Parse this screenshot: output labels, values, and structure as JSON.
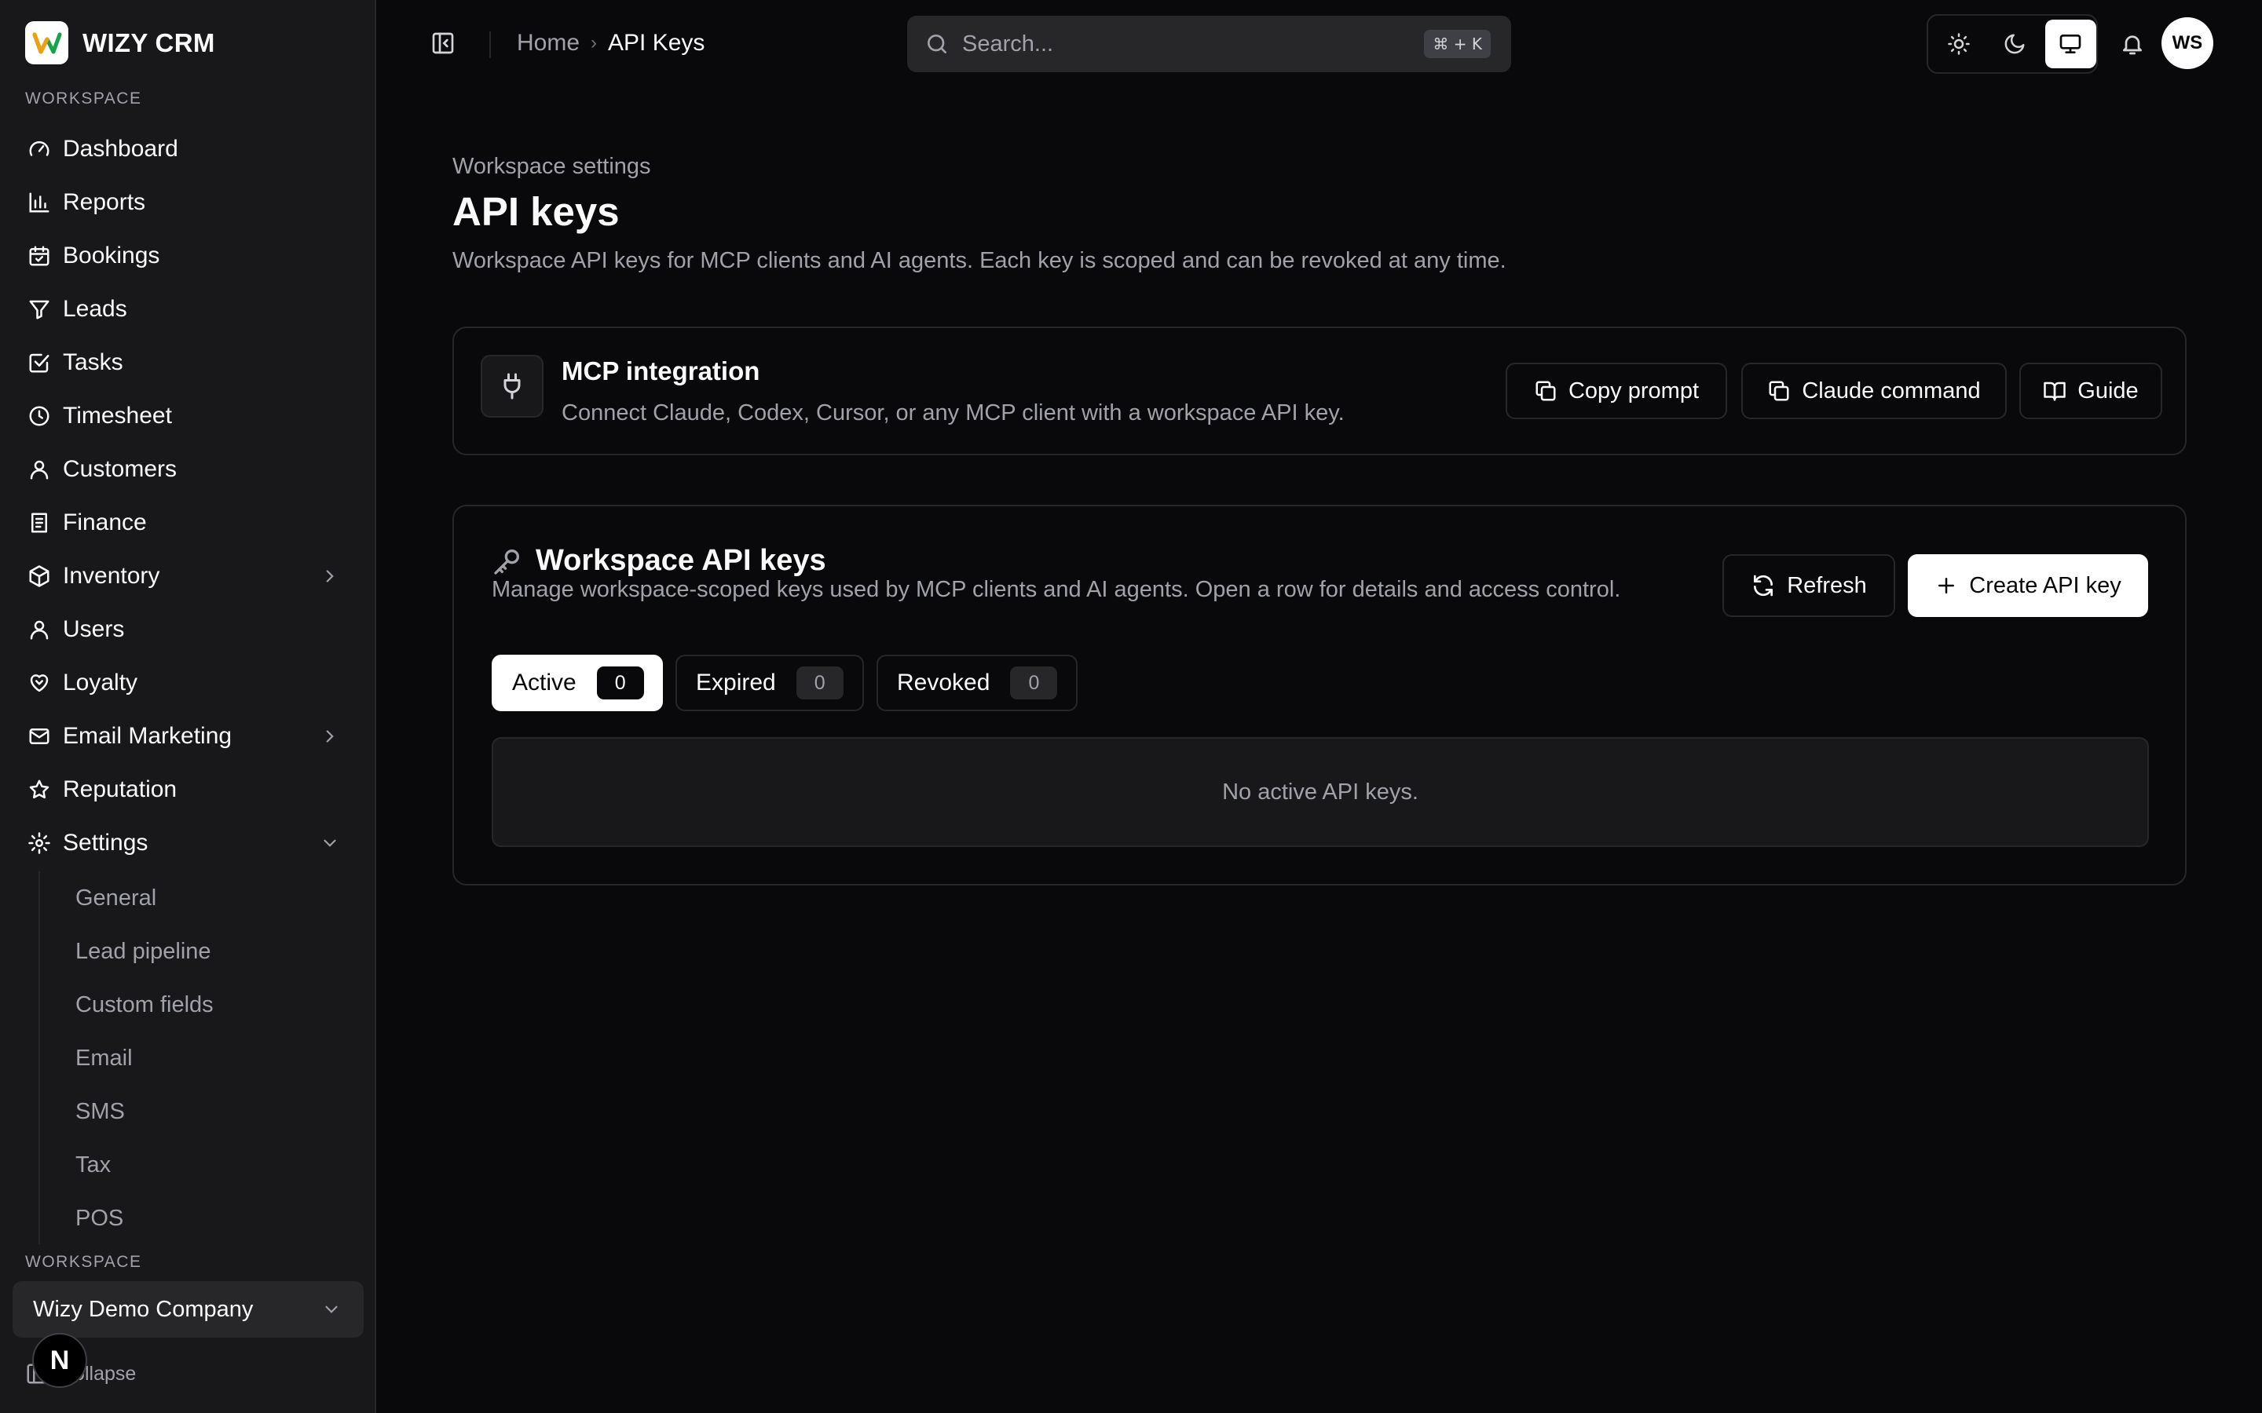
{
  "brand": {
    "name": "WIZY CRM"
  },
  "sidebar": {
    "section_label": "WORKSPACE",
    "items": [
      {
        "label": "Dashboard",
        "icon": "gauge-icon"
      },
      {
        "label": "Reports",
        "icon": "bar-chart-icon"
      },
      {
        "label": "Bookings",
        "icon": "calendar-check-icon"
      },
      {
        "label": "Leads",
        "icon": "funnel-icon"
      },
      {
        "label": "Tasks",
        "icon": "checkbox-icon"
      },
      {
        "label": "Timesheet",
        "icon": "clock-icon"
      },
      {
        "label": "Customers",
        "icon": "user-icon"
      },
      {
        "label": "Finance",
        "icon": "receipt-icon"
      },
      {
        "label": "Inventory",
        "icon": "box-icon"
      },
      {
        "label": "Users",
        "icon": "user-icon"
      },
      {
        "label": "Loyalty",
        "icon": "heart-handshake-icon"
      },
      {
        "label": "Email Marketing",
        "icon": "mail-icon"
      },
      {
        "label": "Reputation",
        "icon": "star-icon"
      },
      {
        "label": "Settings",
        "icon": "gear-icon"
      }
    ],
    "settings_sub": [
      "General",
      "Lead pipeline",
      "Custom fields",
      "Email",
      "SMS",
      "Tax",
      "POS"
    ],
    "workspace_label": "WORKSPACE",
    "workspace_name": "Wizy Demo Company",
    "collapse_label": "Collapse",
    "badge_letter": "N"
  },
  "topbar": {
    "breadcrumb": {
      "home": "Home",
      "separator": "›",
      "current": "API Keys"
    },
    "search": {
      "placeholder": "Search...",
      "shortcut": "⌘ + K"
    },
    "avatar_initials": "WS"
  },
  "page": {
    "eyebrow": "Workspace settings",
    "title": "API keys",
    "description": "Workspace API keys for MCP clients and AI agents. Each key is scoped and can be revoked at any time."
  },
  "mcp": {
    "title": "MCP integration",
    "description": "Connect Claude, Codex, Cursor, or any MCP client with a workspace API key.",
    "buttons": {
      "copy_prompt": "Copy prompt",
      "claude_command": "Claude command",
      "guide": "Guide"
    }
  },
  "keys": {
    "title": "Workspace API keys",
    "description": "Manage workspace-scoped keys used by MCP clients and AI agents. Open a row for details and access control.",
    "refresh_label": "Refresh",
    "create_label": "Create API key",
    "tabs": [
      {
        "label": "Active",
        "count": "0"
      },
      {
        "label": "Expired",
        "count": "0"
      },
      {
        "label": "Revoked",
        "count": "0"
      }
    ],
    "empty_text": "No active API keys."
  },
  "colors": {
    "background": "#09090b",
    "sidebar": "#18181b",
    "border": "#27272a",
    "muted_text": "#a1a1aa",
    "accent": "#ffffff"
  }
}
